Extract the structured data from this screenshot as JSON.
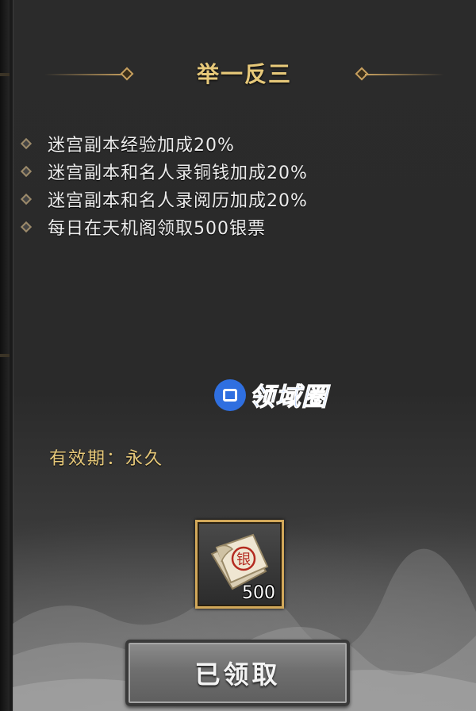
{
  "card": {
    "title": "举一反三",
    "benefits": [
      "迷宫副本经验加成20%",
      "迷宫副本和名人录铜钱加成20%",
      "迷宫副本和名人录阅历加成20%",
      "每日在天机阁领取500银票"
    ],
    "validity": {
      "label": "有效期：",
      "value": "永久"
    }
  },
  "reward": {
    "icon": "silver-note-icon",
    "stamp": "银",
    "count": "500"
  },
  "claim_button": {
    "label": "已领取"
  },
  "watermark": {
    "text": "领域圈"
  },
  "colors": {
    "gold_text": "#e7c97a",
    "ornament": "#c7a05f",
    "item_border": "#d2a85a",
    "watermark_blue": "#3d86ff"
  }
}
